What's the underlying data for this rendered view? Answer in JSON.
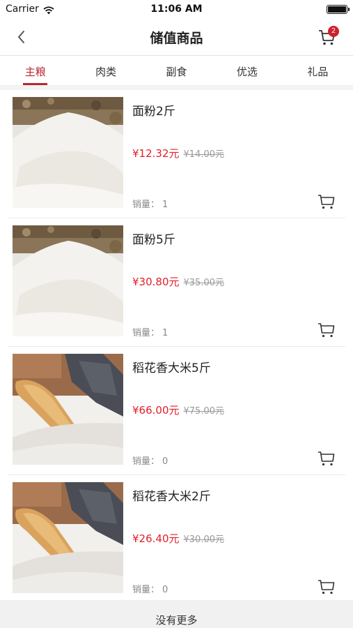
{
  "status_bar": {
    "carrier": "Carrier",
    "time": "11:06 AM"
  },
  "nav": {
    "title": "储值商品",
    "cart_badge": "2"
  },
  "tabs": [
    {
      "label": "主粮",
      "active": true
    },
    {
      "label": "肉类",
      "active": false
    },
    {
      "label": "副食",
      "active": false
    },
    {
      "label": "优选",
      "active": false
    },
    {
      "label": "礼品",
      "active": false
    }
  ],
  "sales_label": "销量：",
  "products": [
    {
      "name": "面粉2斤",
      "price": "¥12.32元",
      "original_price": "¥14.00元",
      "sales": "1",
      "image": "flour"
    },
    {
      "name": "面粉5斤",
      "price": "¥30.80元",
      "original_price": "¥35.00元",
      "sales": "1",
      "image": "flour"
    },
    {
      "name": "稻花香大米5斤",
      "price": "¥66.00元",
      "original_price": "¥75.00元",
      "sales": "0",
      "image": "rice"
    },
    {
      "name": "稻花香大米2斤",
      "price": "¥26.40元",
      "original_price": "¥30.00元",
      "sales": "0",
      "image": "rice"
    }
  ],
  "footer": {
    "text": "没有更多"
  },
  "colors": {
    "accent": "#b8272f",
    "price": "#e2202b",
    "badge": "#d0202a"
  }
}
